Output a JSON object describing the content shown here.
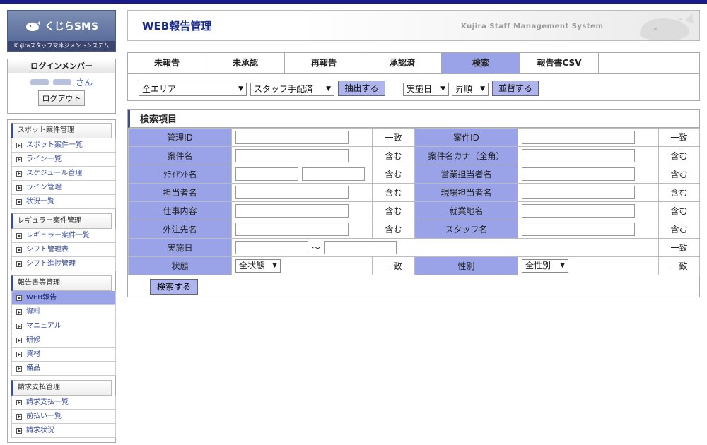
{
  "logo": {
    "name": "くじらSMS",
    "subtitle": "Kujiraスタッフマネジメントシステム"
  },
  "login": {
    "title": "ログインメンバー",
    "suffix": "さん",
    "logout_label": "ログアウト"
  },
  "sidebar": {
    "groups": [
      {
        "title": "スポット案件管理",
        "items": [
          "スポット案件一覧",
          "ライン一覧",
          "スケジュール管理",
          "ライン管理",
          "状況一覧"
        ]
      },
      {
        "title": "レギュラー案件管理",
        "items": [
          "レギュラー案件一覧",
          "シフト管理表",
          "シフト進捗管理"
        ]
      },
      {
        "title": "報告書等管理",
        "items": [
          "WEB報告",
          "資料",
          "マニュアル",
          "研修",
          "資材",
          "備品"
        ],
        "active_index": 0
      },
      {
        "title": "請求支払管理",
        "items": [
          "請求支払一覧",
          "前払い一覧",
          "請求状況"
        ]
      }
    ]
  },
  "header": {
    "title": "WEB報告管理",
    "system_name": "Kujira Staff Management System"
  },
  "tabs": [
    "未報告",
    "未承認",
    "再報告",
    "承認済",
    "検索",
    "報告書CSV"
  ],
  "active_tab": 4,
  "filters": {
    "area": "全エリア",
    "staff_status": "スタッフ手配済",
    "extract_label": "抽出する",
    "sort_key": "実施日",
    "sort_order": "昇順",
    "sort_label": "並替する"
  },
  "search": {
    "title": "検索項目",
    "rows": [
      {
        "label1": "管理ID",
        "mode1": "一致",
        "label2": "案件ID",
        "mode2": "一致"
      },
      {
        "label1": "案件名",
        "mode1": "含む",
        "label2": "案件名カナ（全角）",
        "mode2": "含む"
      },
      {
        "label1": "ｸﾗｲｱﾝﾄ名",
        "mode1": "含む",
        "label2": "営業担当者名",
        "mode2": "含む"
      },
      {
        "label1": "担当者名",
        "mode1": "含む",
        "label2": "現場担当者名",
        "mode2": "含む"
      },
      {
        "label1": "仕事内容",
        "mode1": "含む",
        "label2": "就業地名",
        "mode2": "含む"
      },
      {
        "label1": "外注先名",
        "mode1": "含む",
        "label2": "スタッフ名",
        "mode2": "含む"
      }
    ],
    "date_label": "実施日",
    "date_sep": "～",
    "date_mode": "一致",
    "status_label": "状態",
    "status_value": "全状態",
    "status_mode": "一致",
    "gender_label": "性別",
    "gender_value": "全性別",
    "gender_mode": "一致",
    "submit_label": "検索する"
  },
  "colors": {
    "accent": "#9aa3e8",
    "button": "#aeb5ee",
    "brand": "#1a1a8a"
  }
}
